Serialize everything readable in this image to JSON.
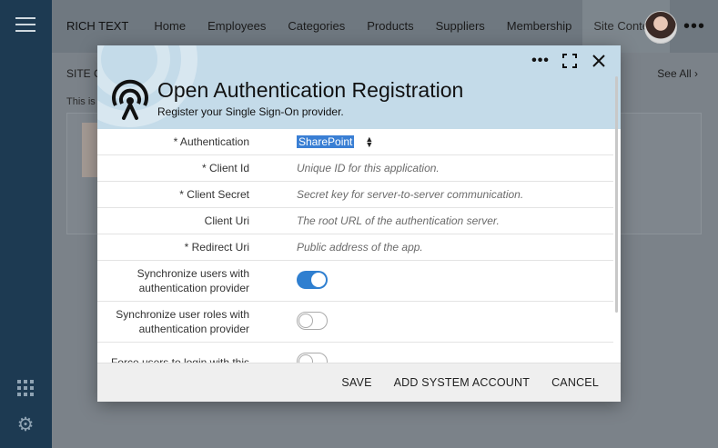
{
  "topnav": {
    "brand": "RICH TEXT",
    "items": [
      "Home",
      "Employees",
      "Categories",
      "Products",
      "Suppliers",
      "Membership",
      "Site Content"
    ],
    "active_item": "Site Content",
    "more_icon": "more-horizontal-icon"
  },
  "sidebar": {
    "menu_icon": "hamburger-menu-icon",
    "apps_icon": "apps-grid-icon",
    "settings_icon": "gear-icon"
  },
  "page": {
    "section_title": "SITE CO",
    "see_all": "See All",
    "description": "This is"
  },
  "modal": {
    "title": "Open Authentication Registration",
    "subtitle": "Register your Single Sign-On provider.",
    "logo_icon": "broadcast-signal-icon",
    "fields": [
      {
        "label": "* Authentication",
        "value": "SharePoint",
        "kind": "select"
      },
      {
        "label": "* Client Id",
        "placeholder": "Unique ID for this application."
      },
      {
        "label": "* Client Secret",
        "placeholder": "Secret key for server-to-server communication."
      },
      {
        "label": "Client Uri",
        "placeholder": "The root URL of the authentication server."
      },
      {
        "label": "* Redirect Uri",
        "placeholder": "Public address of the app."
      }
    ],
    "toggles": [
      {
        "label": "Synchronize users with authentication provider",
        "on": true
      },
      {
        "label": "Synchronize user roles with authentication provider",
        "on": false
      },
      {
        "label": "Force users to login with this",
        "on": false
      }
    ],
    "footer": {
      "save": "SAVE",
      "add_system_account": "ADD SYSTEM ACCOUNT",
      "cancel": "CANCEL"
    },
    "colors": {
      "header_bg": "#c4dbe9",
      "accent": "#2f7fd0"
    }
  }
}
